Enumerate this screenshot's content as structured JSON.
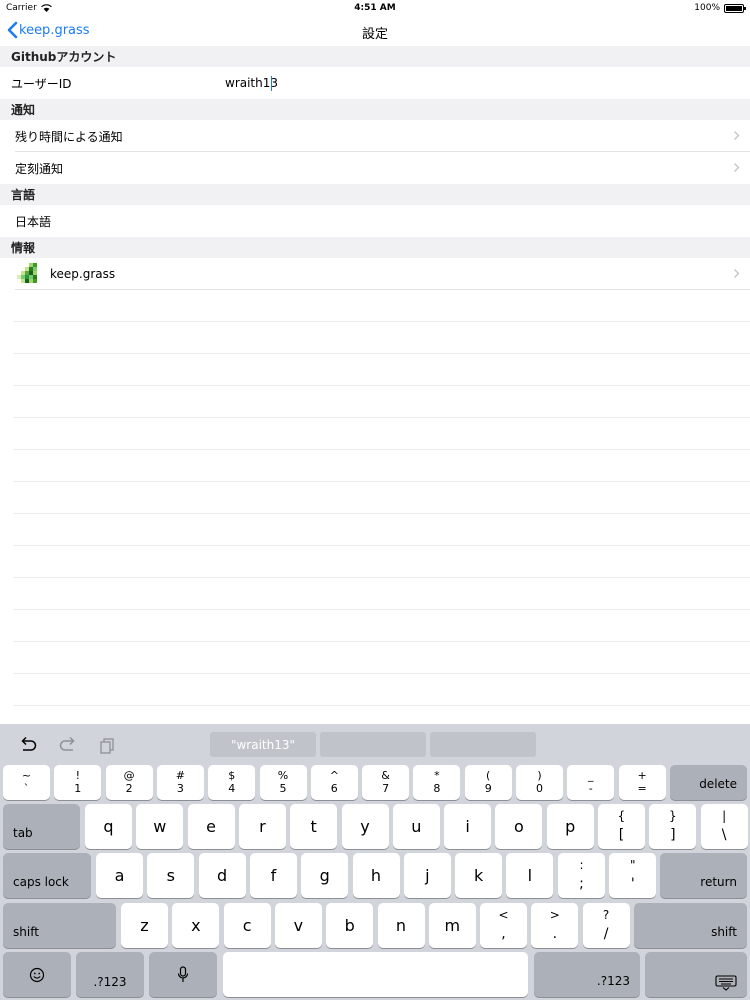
{
  "status_bar": {
    "carrier": "Carrier",
    "time": "4:51 AM",
    "battery": "100%",
    "battery_level": 1.0
  },
  "nav": {
    "back_label": "keep.grass",
    "title": "設定"
  },
  "sections": {
    "github": {
      "header": "Githubアカウント",
      "user_id_label": "ユーザーID",
      "user_id_value": "wraith13"
    },
    "notification": {
      "header": "通知",
      "remaining_label": "残り時間による通知",
      "scheduled_label": "定刻通知"
    },
    "language": {
      "header": "言語",
      "current": "日本語"
    },
    "info": {
      "header": "情報",
      "app_name": "keep.grass"
    }
  },
  "keyboard": {
    "suggestions": [
      "\"wraith13\"",
      "",
      ""
    ],
    "number_row": [
      {
        "top": "~",
        "bot": "`"
      },
      {
        "top": "!",
        "bot": "1"
      },
      {
        "top": "@",
        "bot": "2"
      },
      {
        "top": "#",
        "bot": "3"
      },
      {
        "top": "$",
        "bot": "4"
      },
      {
        "top": "%",
        "bot": "5"
      },
      {
        "top": "^",
        "bot": "6"
      },
      {
        "top": "&",
        "bot": "7"
      },
      {
        "top": "*",
        "bot": "8"
      },
      {
        "top": "(",
        "bot": "9"
      },
      {
        "top": ")",
        "bot": "0"
      },
      {
        "top": "_",
        "bot": "-"
      },
      {
        "top": "+",
        "bot": "="
      }
    ],
    "delete": "delete",
    "tab": "tab",
    "row_q": [
      "q",
      "w",
      "e",
      "r",
      "t",
      "y",
      "u",
      "i",
      "o",
      "p"
    ],
    "row_q_extra": [
      {
        "top": "{",
        "bot": "["
      },
      {
        "top": "}",
        "bot": "]"
      },
      {
        "top": "|",
        "bot": "\\"
      }
    ],
    "caps_lock": "caps lock",
    "row_a": [
      "a",
      "s",
      "d",
      "f",
      "g",
      "h",
      "j",
      "k",
      "l"
    ],
    "row_a_extra": [
      {
        "top": ":",
        "bot": ";"
      },
      {
        "top": "\"",
        "bot": "'"
      }
    ],
    "return": "return",
    "shift": "shift",
    "row_z": [
      "z",
      "x",
      "c",
      "v",
      "b",
      "n",
      "m"
    ],
    "row_z_extra": [
      {
        "top": "<",
        "bot": ","
      },
      {
        "top": ">",
        "bot": "."
      },
      {
        "top": "?",
        "bot": "/"
      }
    ],
    "numbers_label": ".?123"
  }
}
